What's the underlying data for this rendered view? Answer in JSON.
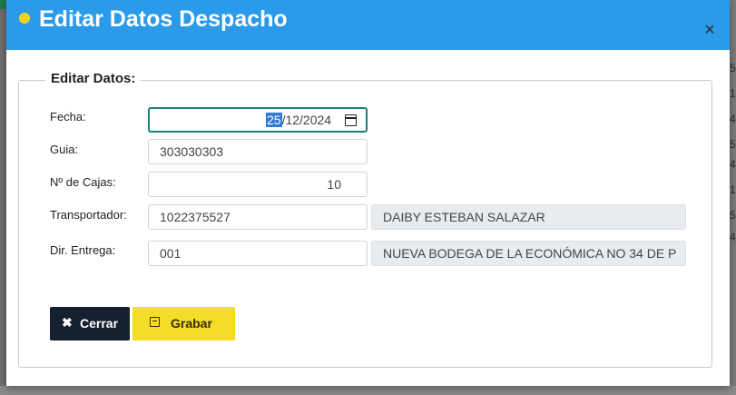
{
  "modal": {
    "title": "Editar Datos Despacho",
    "close_symbol": "×"
  },
  "form": {
    "legend": "Editar Datos:",
    "fecha": {
      "label": "Fecha:",
      "day": "25",
      "rest": "/12/2024",
      "icon": "calendar-icon"
    },
    "guia": {
      "label": "Guia:",
      "value": "303030303"
    },
    "cajas": {
      "label": "Nº de Cajas:",
      "value": "10"
    },
    "transportador": {
      "label": "Transportador:",
      "code": "1022375527",
      "name": "DAIBY ESTEBAN SALAZAR"
    },
    "dir_entrega": {
      "label": "Dir. Entrega:",
      "code": "001",
      "address": "NUEVA BODEGA DE LA ECONÓMICA  NO 34 DE P"
    }
  },
  "buttons": {
    "cerrar": {
      "label": "Cerrar",
      "icon": "close-icon"
    },
    "grabar": {
      "label": "Grabar",
      "icon": "save-icon"
    }
  },
  "background": {
    "right_column_digits": [
      "5",
      "1",
      "4",
      "5",
      "4",
      "1",
      "5",
      "4"
    ]
  },
  "colors": {
    "header": "#2b9be9",
    "accent_dot": "#f3d21f",
    "close_button": "#15202f",
    "save_button": "#f3dd26",
    "focus_border": "#1e7f73"
  }
}
